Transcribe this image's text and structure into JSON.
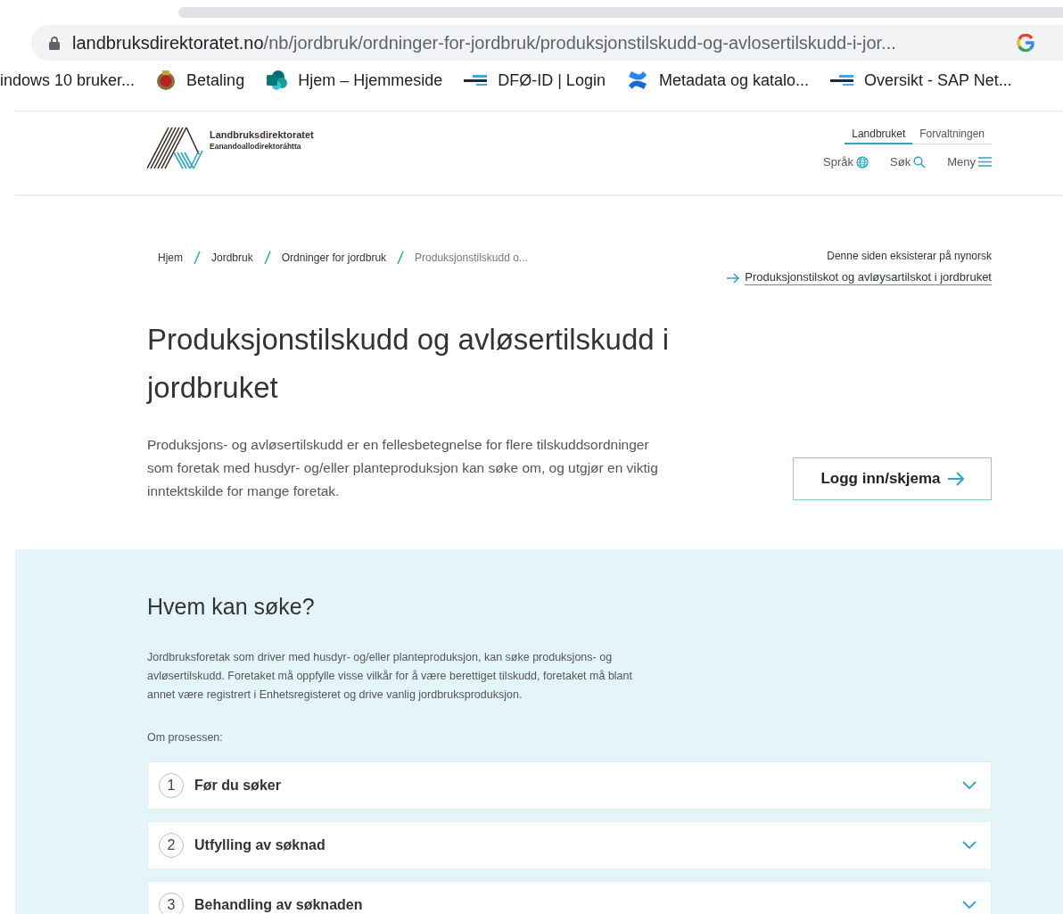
{
  "browser": {
    "url_host": "landbruksdirektoratet.no",
    "url_path": "/nb/jordbruk/ordninger-for-jordbruk/produksjonstilskudd-og-avlosertilskudd-i-jor...",
    "bookmarks": [
      {
        "label": "indows 10 bruker...",
        "kind": "none"
      },
      {
        "label": "Betaling",
        "kind": "emblem"
      },
      {
        "label": "Hjem – Hjemmeside",
        "kind": "sharepoint"
      },
      {
        "label": "DFØ-ID | Login",
        "kind": "dash"
      },
      {
        "label": "Metadata og katalo...",
        "kind": "confluence"
      },
      {
        "label": "Oversikt - SAP Net...",
        "kind": "dash"
      }
    ]
  },
  "header": {
    "logo_name": "Landbruksdirektoratet",
    "logo_subtitle": "Eanandoallodirektoráhtta",
    "audience_tabs": [
      {
        "label": "Landbruket",
        "selected": true
      },
      {
        "label": "Forvaltningen",
        "selected": false
      }
    ],
    "tools": [
      {
        "label": "Språk",
        "kind": "globe"
      },
      {
        "label": "Søk",
        "kind": "search"
      },
      {
        "label": "Meny",
        "kind": "menu"
      }
    ]
  },
  "breadcrumb": [
    {
      "label": "Hjem",
      "current": false
    },
    {
      "label": "Jordbruk",
      "current": false
    },
    {
      "label": "Ordninger for jordbruk",
      "current": false
    },
    {
      "label": "Produksjonstilskudd o...",
      "current": true
    }
  ],
  "language_notice": {
    "text": "Denne siden eksisterar på nynorsk",
    "link": "Produksjonstilskot og avløysartilskot i jordbruket"
  },
  "title": "Produksjonstilskudd og avløsertilskudd i jordbruket",
  "lead": "Produksjons- og avløsertilskudd er en fellesbetegnelse for flere tilskuddsordninger som foretak med husdyr- og/eller planteproduksjon kan søke om, og utgjør en viktig inntektskilde for mange foretak.",
  "login_button": "Logg inn/skjema",
  "who_can_apply": {
    "heading": "Hvem kan søke?",
    "text": "Jordbruksforetak som driver med husdyr- og/eller planteproduksjon, kan søke produksjons- og avløsertilskudd. Foretaket må oppfylle visse vilkår for å være berettiget tilskudd, foretaket må blant annet være registrert i Enhetsregisteret og drive vanlig jordbruksproduksjon.",
    "process_label": "Om prosessen:",
    "steps": [
      {
        "number": "1",
        "title": "Før du søker",
        "expanded": false
      },
      {
        "number": "2",
        "title": "Utfylling av søknad",
        "expanded": false
      },
      {
        "number": "3",
        "title": "Behandling av søknaden",
        "expanded": false
      }
    ]
  }
}
